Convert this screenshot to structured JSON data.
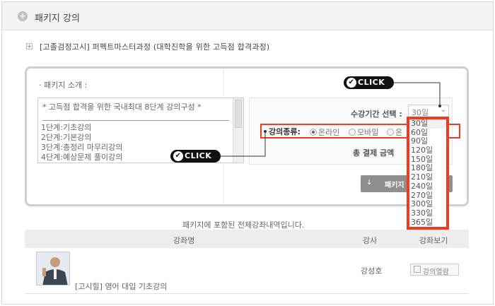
{
  "header": {
    "title": "패키지 강의"
  },
  "course": {
    "title": "[고졸검정고시] 퍼펙트마스터과정 (대학진학을 위한 고득점 합격과정)"
  },
  "intro": {
    "label": "· 패키지 소개 :",
    "headline": "* 고득점 합격을 위한 국내최대 8단계 강의구성 *",
    "steps": [
      "1단계:기초강의",
      "2단계:기본강의",
      "3단계:총정리 마무리강의",
      "4단계:예상문제 풀이강의"
    ]
  },
  "options": {
    "period_label": "수강기간 선택 :",
    "period_selected": "30일",
    "period_options": [
      "30일",
      "60일",
      "90일",
      "120일",
      "150일",
      "180일",
      "210일",
      "240일",
      "270일",
      "300일",
      "330일",
      "365일"
    ],
    "type_label": "강의종류:",
    "types": [
      "온라인",
      "모바일",
      "온"
    ],
    "total_label": "총 결제 금액",
    "package_button": "패키지"
  },
  "annotations": {
    "click_top": "CLICK",
    "click_bottom": "CLICK"
  },
  "table": {
    "notice": "패키지에 포함된 전체강좌내역입니다.",
    "headers": {
      "course": "강좌명",
      "teacher": "강사",
      "view": "강좌보기"
    },
    "rows": [
      {
        "course": "[고시힐] 영어 대입 기초강의",
        "teacher": "강성호",
        "view": "강의열람"
      }
    ]
  }
}
